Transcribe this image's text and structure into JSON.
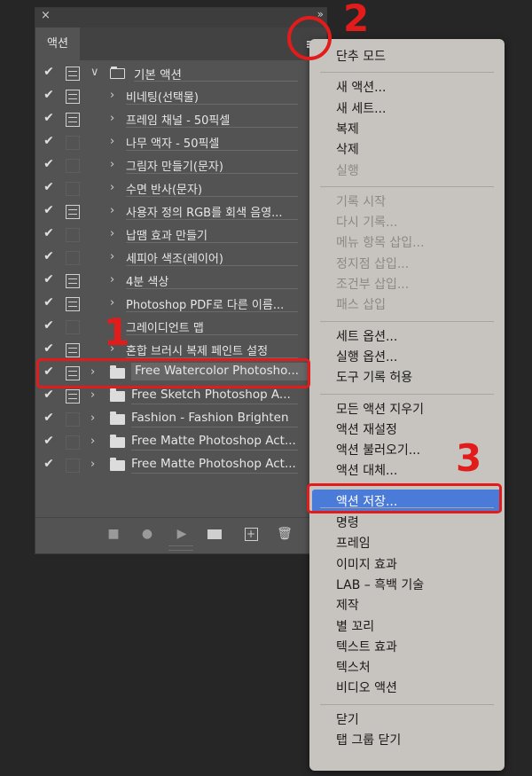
{
  "panel": {
    "tab_label": "액션",
    "close_glyph": "×",
    "collapse_glyph": "»",
    "rows": [
      {
        "label": "기본 액션",
        "checked": true,
        "dialog": true,
        "type": "set",
        "expanded": true
      },
      {
        "label": "비네팅(선택물)",
        "checked": true,
        "dialog": true,
        "type": "action"
      },
      {
        "label": "프레임 채널 - 50픽셀",
        "checked": true,
        "dialog": true,
        "type": "action"
      },
      {
        "label": "나무 액자 - 50픽셀",
        "checked": true,
        "dialog": false,
        "type": "action"
      },
      {
        "label": "그림자 만들기(문자)",
        "checked": true,
        "dialog": false,
        "type": "action"
      },
      {
        "label": "수면 반사(문자)",
        "checked": true,
        "dialog": false,
        "type": "action"
      },
      {
        "label": "사용자 정의 RGB를 회색 음영...",
        "checked": true,
        "dialog": true,
        "type": "action"
      },
      {
        "label": "납땜 효과 만들기",
        "checked": true,
        "dialog": false,
        "type": "action"
      },
      {
        "label": "세피아 색조(레이어)",
        "checked": true,
        "dialog": false,
        "type": "action"
      },
      {
        "label": "4분 색상",
        "checked": true,
        "dialog": true,
        "type": "action"
      },
      {
        "label": "Photoshop PDF로 다른 이름...",
        "checked": true,
        "dialog": true,
        "type": "action"
      },
      {
        "label": "그레이디언트 맵",
        "checked": true,
        "dialog": false,
        "type": "action-noarrow"
      },
      {
        "label": "혼합 브러시 복제 페인트 설정",
        "checked": true,
        "dialog": true,
        "type": "action"
      },
      {
        "label": "Free Watercolor Photosho...",
        "checked": true,
        "dialog": true,
        "type": "set",
        "selected": true
      },
      {
        "label": "Free Sketch Photoshop A...",
        "checked": true,
        "dialog": true,
        "type": "set"
      },
      {
        "label": "Fashion - Fashion Brighten",
        "checked": true,
        "dialog": false,
        "type": "set"
      },
      {
        "label": "Free Matte Photoshop Act...",
        "checked": true,
        "dialog": false,
        "type": "set"
      },
      {
        "label": "Free Matte Photoshop Act...",
        "checked": true,
        "dialog": false,
        "type": "set"
      }
    ],
    "bottom_buttons": [
      "stop-icon",
      "record-icon",
      "play-icon",
      "new-set-icon",
      "new-action-icon",
      "trash-icon"
    ]
  },
  "menu": {
    "items": [
      {
        "label": "단추 모드",
        "disabled": false
      },
      {
        "sep": true
      },
      {
        "label": "새 액션...",
        "disabled": false
      },
      {
        "label": "새 세트...",
        "disabled": false
      },
      {
        "label": "복제",
        "disabled": false
      },
      {
        "label": "삭제",
        "disabled": false
      },
      {
        "label": "실행",
        "disabled": true
      },
      {
        "sep": true
      },
      {
        "label": "기록 시작",
        "disabled": true
      },
      {
        "label": "다시 기록...",
        "disabled": true
      },
      {
        "label": "메뉴 항목 삽입...",
        "disabled": true
      },
      {
        "label": "정지점 삽입...",
        "disabled": true
      },
      {
        "label": "조건부 삽입...",
        "disabled": true
      },
      {
        "label": "패스 삽입",
        "disabled": true
      },
      {
        "sep": true
      },
      {
        "label": "세트 옵션...",
        "disabled": false
      },
      {
        "label": "실행 옵션...",
        "disabled": false
      },
      {
        "label": "도구 기록 허용",
        "disabled": false
      },
      {
        "sep": true
      },
      {
        "label": "모든 액션 지우기",
        "disabled": false
      },
      {
        "label": "액션 재설정",
        "disabled": false
      },
      {
        "label": "액션 불러오기...",
        "disabled": false
      },
      {
        "label": "액션 대체...",
        "disabled": false
      },
      {
        "label": "액션 저장...",
        "disabled": false,
        "highlighted": true
      },
      {
        "sep": true
      },
      {
        "label": "명령",
        "disabled": false
      },
      {
        "label": "프레임",
        "disabled": false
      },
      {
        "label": "이미지 효과",
        "disabled": false
      },
      {
        "label": "LAB – 흑백 기술",
        "disabled": false
      },
      {
        "label": "제작",
        "disabled": false
      },
      {
        "label": "별 꼬리",
        "disabled": false
      },
      {
        "label": "텍스트 효과",
        "disabled": false
      },
      {
        "label": "텍스처",
        "disabled": false
      },
      {
        "label": "비디오 액션",
        "disabled": false
      },
      {
        "sep": true
      },
      {
        "label": "닫기",
        "disabled": false
      },
      {
        "label": "탭 그룹 닫기",
        "disabled": false
      }
    ]
  },
  "annotations": {
    "step1": "1",
    "step2": "2",
    "step3": "3",
    "color": "#e21b1b"
  },
  "colors": {
    "panel_bg": "#535353",
    "menu_bg": "#c7c3bf",
    "highlight": "#4a7bd8"
  }
}
